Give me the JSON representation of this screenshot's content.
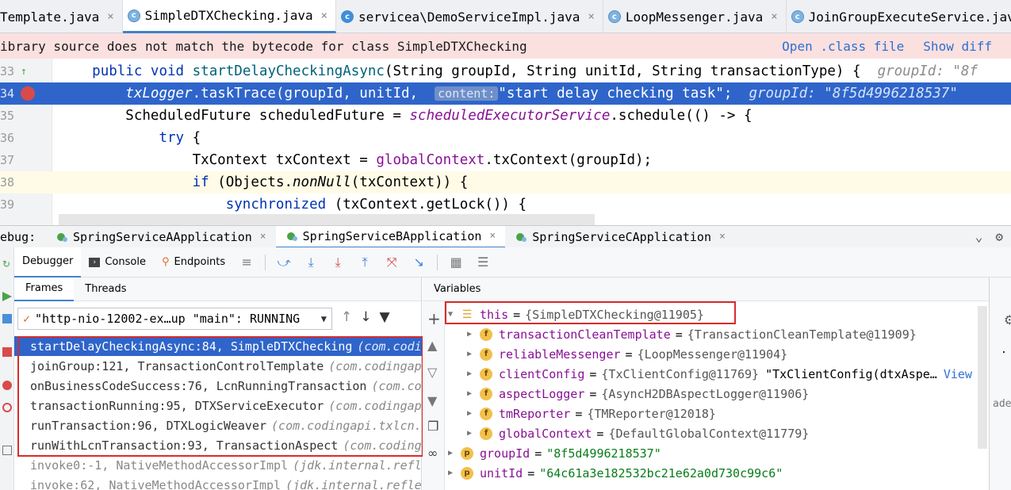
{
  "tabs": [
    {
      "label": "Template.java",
      "icon": "",
      "active": false
    },
    {
      "label": "SimpleDTXChecking.java",
      "icon": "c",
      "active": true
    },
    {
      "label": "servicea\\DemoServiceImpl.java",
      "icon": "c",
      "active": false
    },
    {
      "label": "LoopMessenger.java",
      "icon": "c",
      "active": false
    },
    {
      "label": "JoinGroupExecuteService.java",
      "icon": "c",
      "active": false
    }
  ],
  "close_glyph": "×",
  "banner": {
    "message": "ibrary source does not match the bytecode for class SimpleDTXChecking",
    "open_class": "Open .class file",
    "show_diff": "Show diff"
  },
  "code": {
    "lines": [
      {
        "num": "33",
        "parts": [
          [
            "",
            "    "
          ],
          [
            "kw",
            "public"
          ],
          [
            "",
            " "
          ],
          [
            "kw",
            "void"
          ],
          [
            "",
            " "
          ],
          [
            "fn",
            "startDelayCheckingAsync"
          ],
          [
            "",
            "(String groupId, String unitId, String transactionType) {  "
          ],
          [
            "hint",
            "groupId: \"8f"
          ]
        ]
      },
      {
        "num": "34",
        "parts": [
          [
            "",
            "        "
          ],
          [
            "fld it",
            "txLogger"
          ],
          [
            "",
            ".taskTrace(groupId, unitId,  "
          ],
          [
            "chip",
            "content:"
          ],
          [
            "",
            "\"start delay checking task\";  "
          ],
          [
            "hint",
            "groupId: \"8f5d4996218537\""
          ]
        ]
      },
      {
        "num": "35",
        "parts": [
          [
            "",
            "        ScheduledFuture scheduledFuture = "
          ],
          [
            "fld it",
            "scheduledExecutorService"
          ],
          [
            "",
            ".schedule(() -> {"
          ]
        ]
      },
      {
        "num": "36",
        "parts": [
          [
            "",
            "            "
          ],
          [
            "kw",
            "try"
          ],
          [
            "",
            " {"
          ]
        ]
      },
      {
        "num": "37",
        "parts": [
          [
            "",
            "                TxContext txContext = "
          ],
          [
            "fld",
            "globalContext"
          ],
          [
            "",
            ".txContext(groupId);"
          ]
        ]
      },
      {
        "num": "38",
        "parts": [
          [
            "",
            "                "
          ],
          [
            "kw",
            "if"
          ],
          [
            "",
            " (Objects."
          ],
          [
            "it",
            "nonNull"
          ],
          [
            "",
            "(txContext)) {"
          ]
        ]
      },
      {
        "num": "39",
        "parts": [
          [
            "",
            "                    "
          ],
          [
            "kw",
            "synchronized"
          ],
          [
            "",
            " (txContext.getLock()) {"
          ]
        ]
      }
    ]
  },
  "debug": {
    "label": "ebug:",
    "run_tabs": [
      {
        "label": "SpringServiceAApplication",
        "active": false
      },
      {
        "label": "SpringServiceBApplication",
        "active": true
      },
      {
        "label": "SpringServiceCApplication",
        "active": false
      }
    ],
    "tool_tabs": [
      "Debugger",
      "Console",
      "Endpoints"
    ],
    "frames_tab": "Frames",
    "threads_tab": "Threads",
    "thread_selected": "\"http-nio-12002-ex…up \"main\": RUNNING",
    "frames": [
      {
        "method": "startDelayCheckingAsync:84, SimpleDTXChecking",
        "pkg": "(com.codi"
      },
      {
        "method": "joinGroup:121, TransactionControlTemplate",
        "pkg": "(com.codingap"
      },
      {
        "method": "onBusinessCodeSuccess:76, LcnRunningTransaction",
        "pkg": "(com.co"
      },
      {
        "method": "transactionRunning:95, DTXServiceExecutor",
        "pkg": "(com.codingap"
      },
      {
        "method": "runTransaction:96, DTXLogicWeaver",
        "pkg": "(com.codingapi.txlcn."
      },
      {
        "method": "runWithLcnTransaction:93, TransactionAspect",
        "pkg": "(com.coding"
      },
      {
        "method": "invoke0:-1, NativeMethodAccessorImpl",
        "pkg": "(jdk.internal.refl"
      },
      {
        "method": "invoke:62, NativeMethodAccessorImpl",
        "pkg": "(jdk.internal.refle"
      }
    ],
    "variables_tab": "Variables",
    "variables": [
      {
        "name": "this",
        "value": "{SimpleDTXChecking@11905}",
        "icon": "bars",
        "indent": 0,
        "tri": "▼",
        "extra": "",
        "view": ""
      },
      {
        "name": "transactionCleanTemplate",
        "value": "{TransactionCleanTemplate@11909}",
        "icon": "f",
        "indent": 1,
        "tri": "▶",
        "extra": "",
        "view": ""
      },
      {
        "name": "reliableMessenger",
        "value": "{LoopMessenger@11904}",
        "icon": "f",
        "indent": 1,
        "tri": "▶",
        "extra": "",
        "view": ""
      },
      {
        "name": "clientConfig",
        "value": "{TxClientConfig@11769}",
        "icon": "f",
        "indent": 1,
        "tri": "▶",
        "extra": "\"TxClientConfig(dtxAspe…",
        "view": "View"
      },
      {
        "name": "aspectLogger",
        "value": "{AsyncH2DBAspectLogger@11906}",
        "icon": "f",
        "indent": 1,
        "tri": "▶",
        "extra": "",
        "view": ""
      },
      {
        "name": "tmReporter",
        "value": "{TMReporter@12018}",
        "icon": "f",
        "indent": 1,
        "tri": "▶",
        "extra": "",
        "view": ""
      },
      {
        "name": "globalContext",
        "value": "{DefaultGlobalContext@11779}",
        "icon": "f",
        "indent": 1,
        "tri": "▶",
        "extra": "",
        "view": ""
      },
      {
        "name": "groupId",
        "value": "\"8f5d4996218537\"",
        "icon": "p",
        "indent": 0,
        "tri": "▶",
        "extra": "",
        "view": "",
        "string": true
      },
      {
        "name": "unitId",
        "value": "\"64c61a3e182532bc21e62a0d730c99c6\"",
        "icon": "p",
        "indent": 0,
        "tri": "▶",
        "extra": "",
        "view": "",
        "string": true
      }
    ],
    "right_fragment": "aded"
  },
  "colors": {
    "accent": "#2f65ca",
    "highlight_box": "#d92b2b",
    "banner_bg": "#fbe0e0"
  }
}
